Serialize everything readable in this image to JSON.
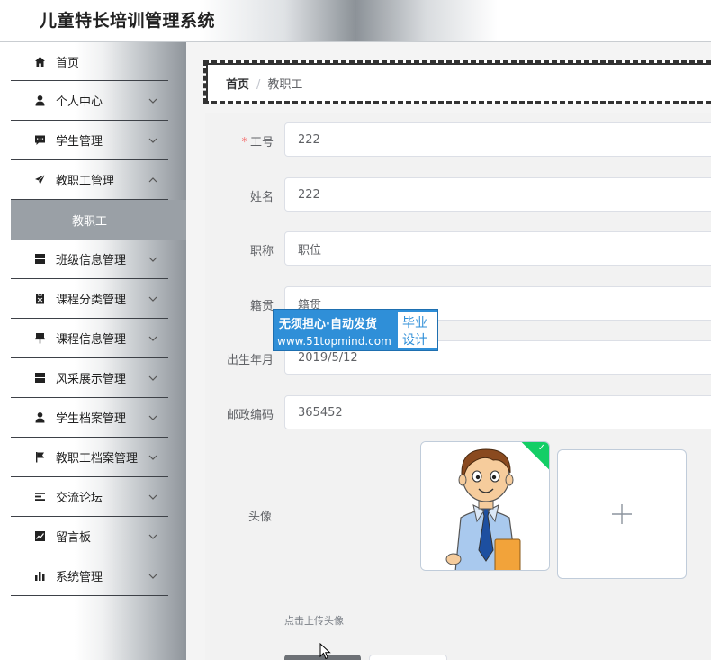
{
  "app": {
    "title": "儿童特长培训管理系统"
  },
  "sidebar": {
    "items": [
      {
        "label": "首页",
        "icon": "home-icon"
      },
      {
        "label": "个人中心",
        "icon": "user-icon"
      },
      {
        "label": "学生管理",
        "icon": "message-icon"
      },
      {
        "label": "教职工管理",
        "icon": "send-icon"
      },
      {
        "label": "班级信息管理",
        "icon": "grid-icon"
      },
      {
        "label": "课程分类管理",
        "icon": "clipboard-icon"
      },
      {
        "label": "课程信息管理",
        "icon": "pin-icon"
      },
      {
        "label": "风采展示管理",
        "icon": "grid-icon"
      },
      {
        "label": "学生档案管理",
        "icon": "user-icon"
      },
      {
        "label": "教职工档案管理",
        "icon": "flag-icon"
      },
      {
        "label": "交流论坛",
        "icon": "list-icon"
      },
      {
        "label": "留言板",
        "icon": "chart-line-icon"
      },
      {
        "label": "系统管理",
        "icon": "bar-chart-icon"
      }
    ],
    "active_sub": "教职工"
  },
  "breadcrumb": {
    "home": "首页",
    "separator": "/",
    "current": "教职工"
  },
  "form": {
    "fields": [
      {
        "label": "工号",
        "value": "222",
        "required": true
      },
      {
        "label": "姓名",
        "value": "222"
      },
      {
        "label": "职称",
        "value": "职位"
      },
      {
        "label": "籍贯",
        "value": "籍贯"
      },
      {
        "label": "出生年月",
        "value": "2019/5/12"
      },
      {
        "label": "邮政编码",
        "value": "365452"
      }
    ],
    "avatar_label": "头像",
    "upload_tip": "点击上传头像"
  },
  "watermark": {
    "line1": "无须担心·自动发货",
    "line2": "www.51topmind.com",
    "right1": "毕业",
    "right2": "设计"
  },
  "colors": {
    "required": "#f56c6c",
    "success": "#13ce66",
    "watermark_bg": "#2f8fd8"
  }
}
